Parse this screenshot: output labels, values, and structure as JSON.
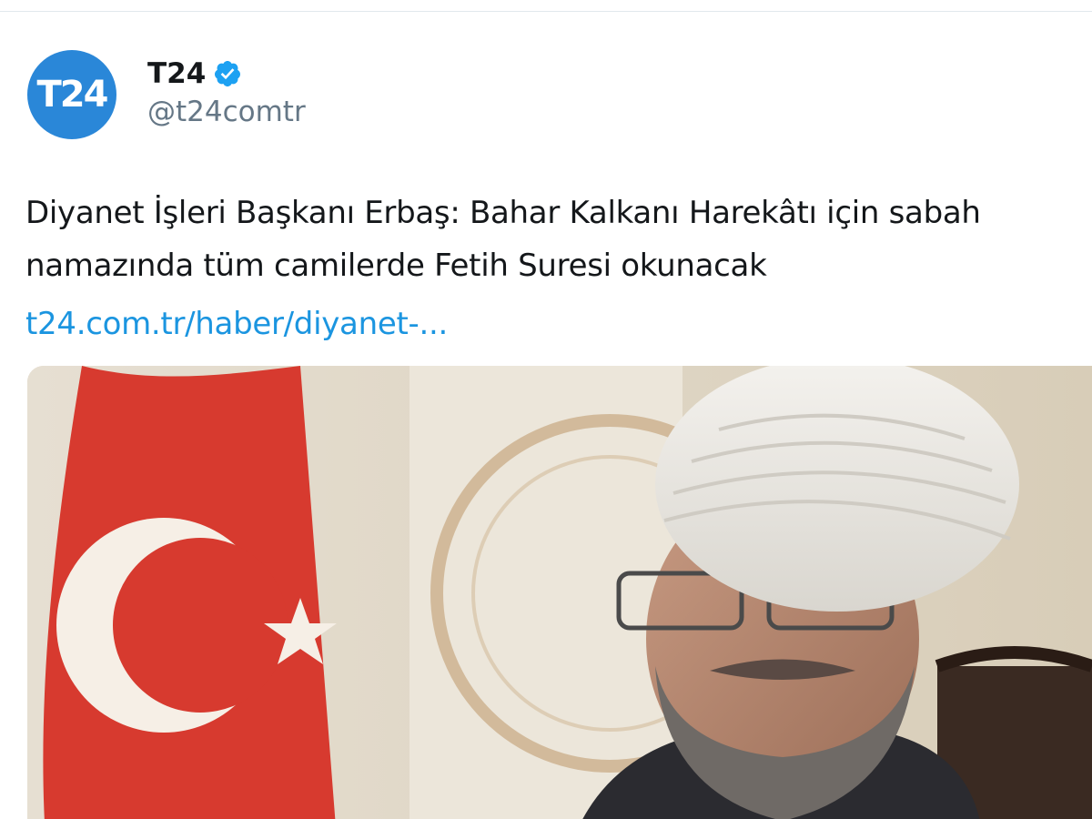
{
  "account": {
    "avatar_text": "T24",
    "avatar_color": "#2a87d8",
    "display_name": "T24",
    "verified_icon": "verified-badge-icon",
    "verified_color": "#1da1f2",
    "handle": "@t24comtr"
  },
  "tweet": {
    "text_line1": "Diyanet İşleri Başkanı Erbaş: Bahar Kalkanı Harekâtı için sabah",
    "text_line2": "namazında tüm camilerde Fetih Suresi okunacak",
    "link": "t24.com.tr/haber/diyanet-...",
    "link_color": "#1b95e0"
  },
  "media": {
    "type": "photo",
    "flag_color": "#d73a2f"
  }
}
